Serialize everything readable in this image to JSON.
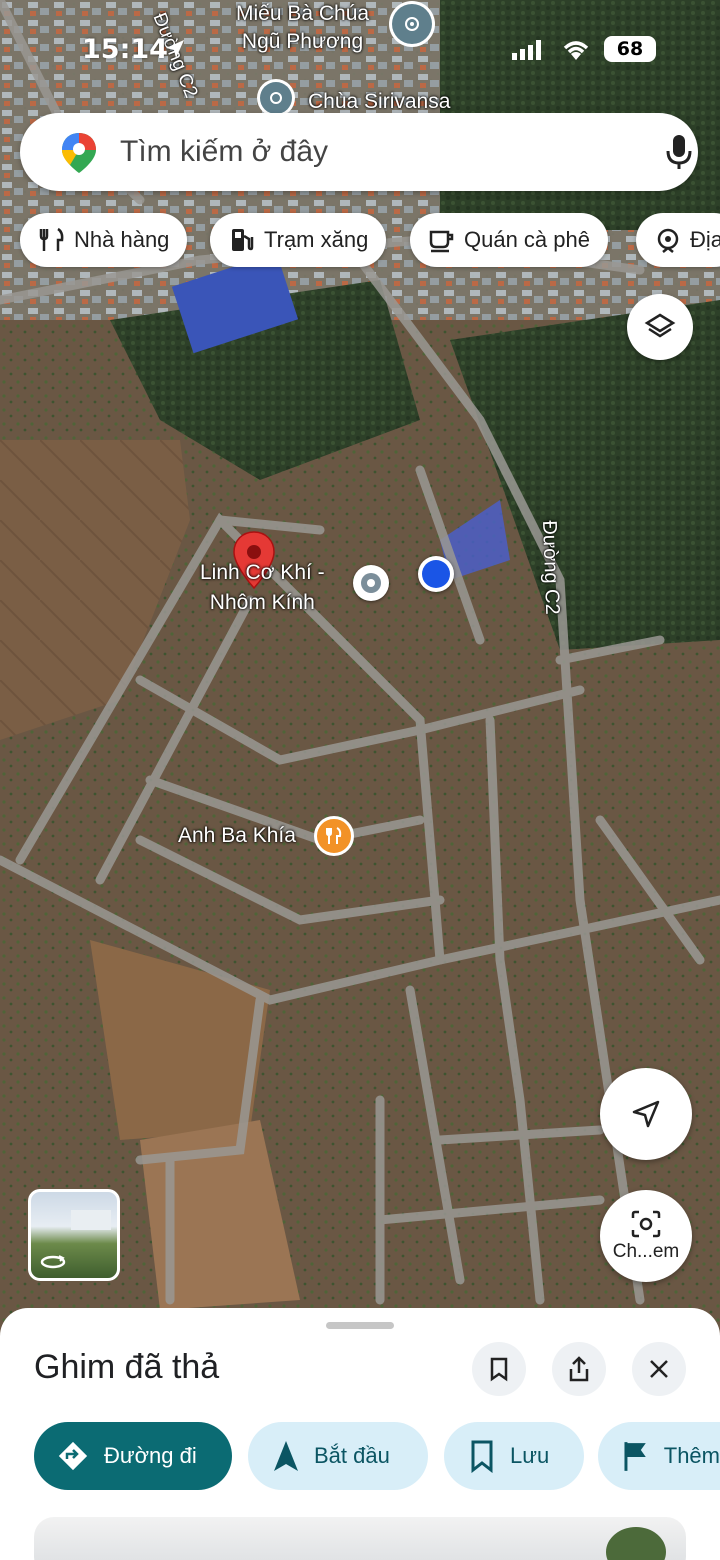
{
  "status_bar": {
    "time": "15:14",
    "battery": "68"
  },
  "map": {
    "labels": {
      "temple": "Miếu Bà Chúa\nNgũ Phương",
      "pagoda": "Chùa Sirivansa",
      "road_top": "Đường C2",
      "road_right": "Đường C2",
      "dropped_place": "Linh Cơ Khí -\nNhôm Kính",
      "restaurant": "Anh Ba Khía"
    }
  },
  "search": {
    "placeholder": "Tìm kiếm ở đây"
  },
  "chips": [
    {
      "label": "Nhà hàng",
      "icon": "fork-knife-icon"
    },
    {
      "label": "Trạm xăng",
      "icon": "gas-station-icon"
    },
    {
      "label": "Quán cà phê",
      "icon": "coffee-icon"
    },
    {
      "label": "Địa",
      "icon": "attractions-icon"
    }
  ],
  "lens_button": {
    "label": "Ch...em"
  },
  "sheet": {
    "title": "Ghim đã thả",
    "actions": [
      {
        "label": "Đường đi",
        "icon": "directions-icon"
      },
      {
        "label": "Bắt đầu",
        "icon": "navigation-icon"
      },
      {
        "label": "Lưu",
        "icon": "bookmark-icon"
      },
      {
        "label": "Thêm",
        "icon": "flag-icon"
      }
    ]
  },
  "colors": {
    "primary_teal": "#0b6b73",
    "secondary_blue": "#d8eef8",
    "pin_red": "#e53935",
    "location_blue": "#1a55e6",
    "restaurant_orange": "#f29227"
  }
}
